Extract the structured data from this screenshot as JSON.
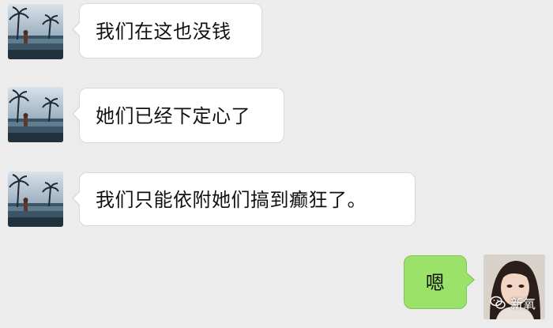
{
  "conversation": {
    "messages": [
      {
        "side": "left",
        "text": "我们在这也没钱",
        "avatar": "resort-pool-avatar"
      },
      {
        "side": "left",
        "text": "她们已经下定心了",
        "avatar": "resort-pool-avatar"
      },
      {
        "side": "left",
        "text": "我们只能依附她们搞到癫狂了。",
        "avatar": "resort-pool-avatar"
      },
      {
        "side": "right",
        "text": "嗯",
        "avatar": "woman-portrait-avatar"
      }
    ]
  },
  "watermark": {
    "text": "新氧",
    "icon": "wechat-icon"
  },
  "colors": {
    "background": "#ececec",
    "incoming_bubble": "#ffffff",
    "outgoing_bubble": "#9ae26a",
    "text": "#111111"
  }
}
